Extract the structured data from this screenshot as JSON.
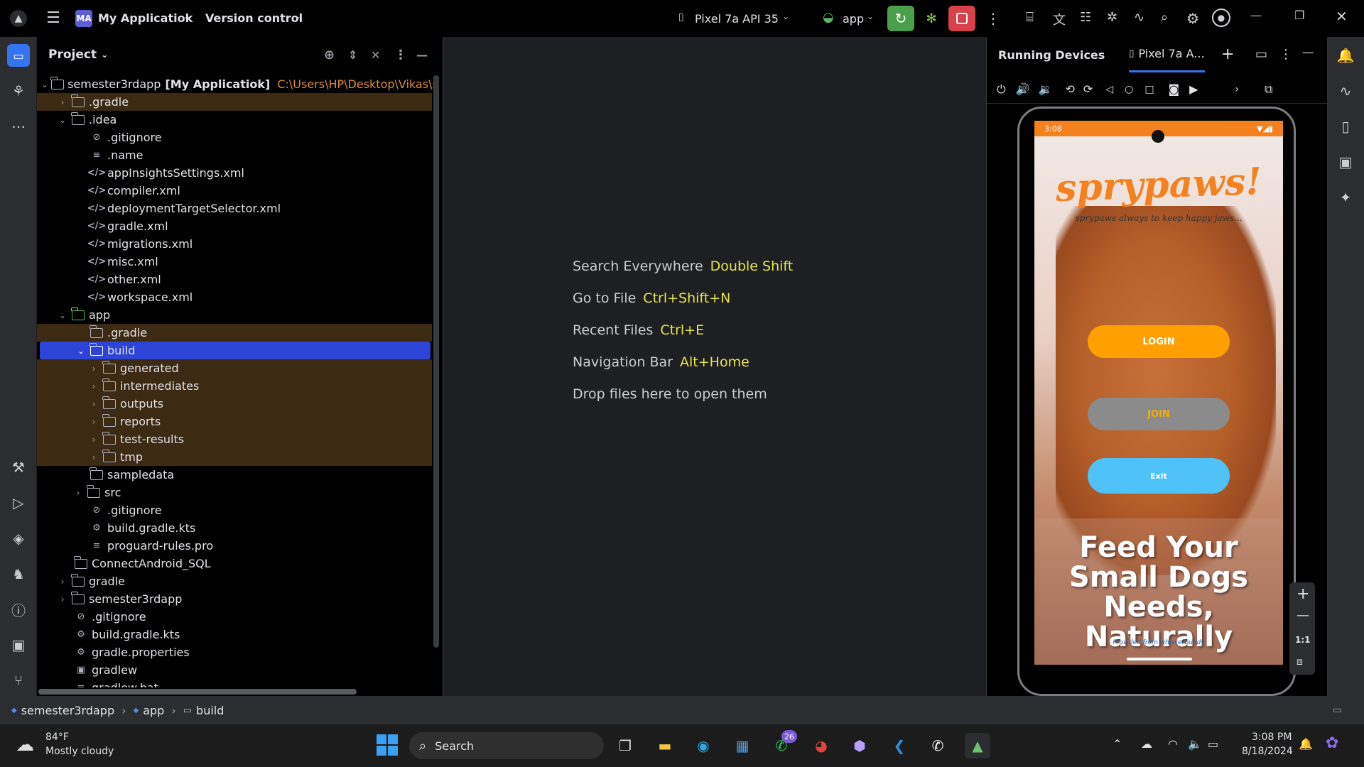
{
  "titlebar": {
    "project_badge": "MA",
    "project_name": "My Applicatiok",
    "vcs": "Version control",
    "device": "Pixel 7a API 35",
    "run_config": "app"
  },
  "project_panel": {
    "title": "Project",
    "root_name": "semester3rdapp",
    "root_module": "[My Applicatiok]",
    "root_path": "C:\\Users\\HP\\Desktop\\Vikas\\s",
    "items": [
      {
        "label": ".gradle"
      },
      {
        "label": ".idea"
      },
      {
        "label": ".gitignore"
      },
      {
        "label": ".name"
      },
      {
        "label": "appInsightsSettings.xml"
      },
      {
        "label": "compiler.xml"
      },
      {
        "label": "deploymentTargetSelector.xml"
      },
      {
        "label": "gradle.xml"
      },
      {
        "label": "migrations.xml"
      },
      {
        "label": "misc.xml"
      },
      {
        "label": "other.xml"
      },
      {
        "label": "workspace.xml"
      },
      {
        "label": "app"
      },
      {
        "label": ".gradle"
      },
      {
        "label": "build"
      },
      {
        "label": "generated"
      },
      {
        "label": "intermediates"
      },
      {
        "label": "outputs"
      },
      {
        "label": "reports"
      },
      {
        "label": "test-results"
      },
      {
        "label": "tmp"
      },
      {
        "label": "sampledata"
      },
      {
        "label": "src"
      },
      {
        "label": ".gitignore"
      },
      {
        "label": "build.gradle.kts"
      },
      {
        "label": "proguard-rules.pro"
      },
      {
        "label": "ConnectAndroid_SQL"
      },
      {
        "label": "gradle"
      },
      {
        "label": "semester3rdapp"
      },
      {
        "label": ".gitignore"
      },
      {
        "label": "build.gradle.kts"
      },
      {
        "label": "gradle.properties"
      },
      {
        "label": "gradlew"
      },
      {
        "label": "gradlew.bat"
      }
    ]
  },
  "editor_hints": [
    {
      "label": "Search Everywhere",
      "key": "Double Shift"
    },
    {
      "label": "Go to File",
      "key": "Ctrl+Shift+N"
    },
    {
      "label": "Recent Files",
      "key": "Ctrl+E"
    },
    {
      "label": "Navigation Bar",
      "key": "Alt+Home"
    },
    {
      "label": "Drop files here to open them",
      "key": ""
    }
  ],
  "devices_panel": {
    "title": "Running Devices",
    "tab": "Pixel 7a A...",
    "zoom_label": "1:1"
  },
  "phone": {
    "time": "3:08",
    "app_title": "sprypaws!",
    "tagline": "sprypaws always to keep happy jaws...",
    "login_label": "LOGIN",
    "join_label": "JOIN",
    "exit_label": "Exit",
    "headline": "Feed Your Small Dogs Needs, Naturally",
    "credit": "Provided from whiskerbuddy"
  },
  "breadcrumb": [
    "semester3rdapp",
    "app",
    "build"
  ],
  "taskbar": {
    "temp": "84°F",
    "weather": "Mostly cloudy",
    "search": "Search",
    "whatsapp_badge": "26",
    "time": "3:08 PM",
    "date": "8/18/2024"
  },
  "colors": {
    "accent_blue": "#2e44d6",
    "highlight_orange": "#3d2a12",
    "shortcut_yellow": "#e5e64a",
    "run_green": "#4a9f4a",
    "stop_red": "#d9414a",
    "brand_orange": "#f4801e",
    "exit_cyan": "#4fc3f7"
  }
}
